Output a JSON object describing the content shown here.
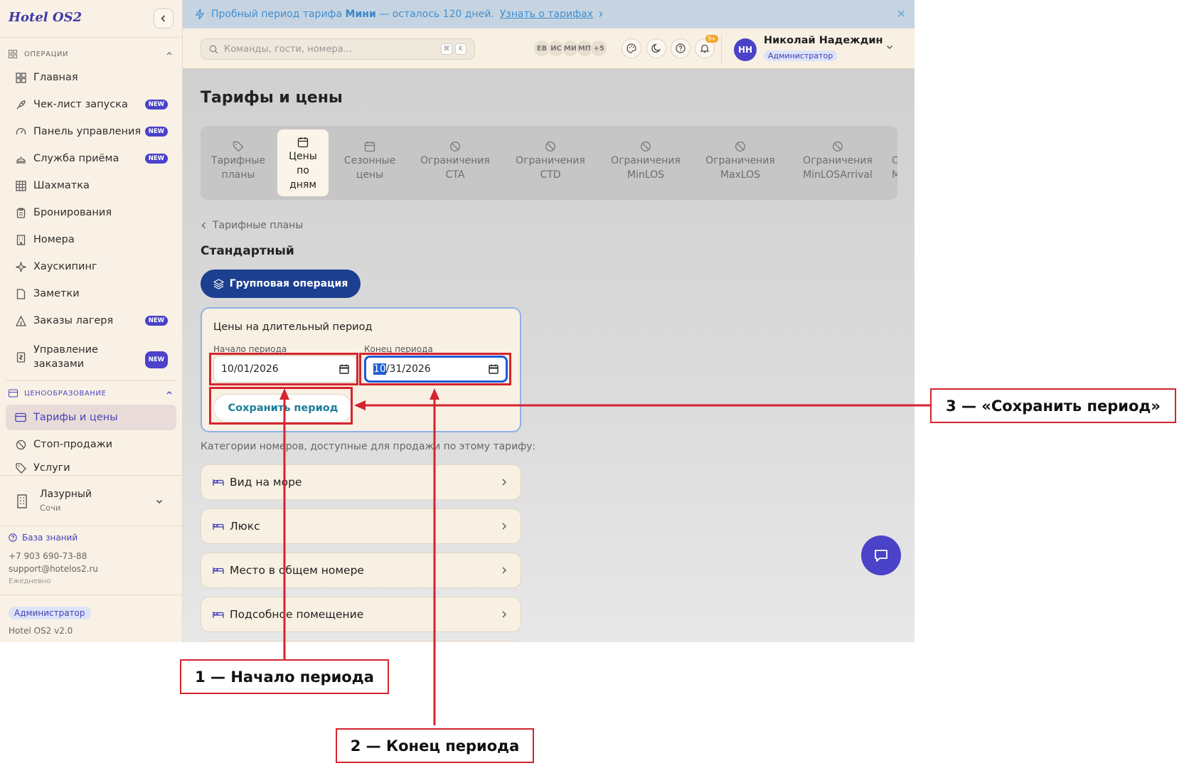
{
  "app": {
    "logo": "Hotel OS2"
  },
  "sidebar": {
    "section_ops": "ОПЕРАЦИИ",
    "section_pricing": "ЦЕНООБРАЗОВАНИЕ",
    "items": [
      {
        "label": "Главная",
        "icon": "dashboard-icon"
      },
      {
        "label": "Чек-лист запуска",
        "icon": "rocket-icon",
        "badge": "NEW"
      },
      {
        "label": "Панель управления",
        "icon": "gauge-icon",
        "badge": "NEW"
      },
      {
        "label": "Служба приёма",
        "icon": "bell-desk-icon",
        "badge": "NEW"
      },
      {
        "label": "Шахматка",
        "icon": "grid-icon"
      },
      {
        "label": "Бронирования",
        "icon": "clipboard-icon"
      },
      {
        "label": "Номера",
        "icon": "building-icon"
      },
      {
        "label": "Хаускипинг",
        "icon": "sparkle-icon"
      },
      {
        "label": "Заметки",
        "icon": "note-icon"
      },
      {
        "label": "Заказы лагеря",
        "icon": "tent-icon",
        "badge": "NEW"
      },
      {
        "label": "Управление заказами",
        "icon": "receipt-icon",
        "badge": "NEW"
      }
    ],
    "pricing_items": [
      {
        "label": "Тарифы и цены",
        "icon": "card-icon",
        "active": true
      },
      {
        "label": "Стоп-продажи",
        "icon": "ban-icon"
      },
      {
        "label": "Услуги",
        "icon": "tag-icon"
      }
    ],
    "hotel": {
      "name": "Лазурный",
      "city": "Сочи"
    },
    "knowledge_base": "База знаний",
    "phone": "+7 903 690-73-88",
    "email": "support@hotelos2.ru",
    "schedule": "Ежедневно",
    "role": "Администратор",
    "version": "Hotel OS2 v2.0"
  },
  "trial": {
    "prefix": "Пробный период тарифа",
    "plan": "Мини",
    "suffix": "— осталось 120 дней.",
    "link": "Узнать о тарифах"
  },
  "topbar": {
    "search_placeholder": "Команды, гости, номера...",
    "kbd1": "⌘",
    "kbd2": "K",
    "presence": [
      "ЕВ",
      "ИС",
      "МИ",
      "МП",
      "+5"
    ],
    "notifications": "9+",
    "user_initials": "НН",
    "user_name": "Николай Надеждин",
    "user_role": "Администратор"
  },
  "main": {
    "title": "Тарифы и цены",
    "tabs": [
      {
        "line1": "Тарифные",
        "line2": "планы",
        "icon": "tag-icon"
      },
      {
        "line1": "Цены",
        "line2": "по",
        "line3": "дням",
        "icon": "calendar-icon",
        "active": true
      },
      {
        "line1": "Сезонные",
        "line2": "цены",
        "icon": "calendar-icon"
      },
      {
        "line1": "Ограничения",
        "line2": "CTA",
        "icon": "ban-icon"
      },
      {
        "line1": "Ограничения",
        "line2": "CTD",
        "icon": "ban-icon"
      },
      {
        "line1": "Ограничения",
        "line2": "MinLOS",
        "icon": "ban-icon"
      },
      {
        "line1": "Ограничения",
        "line2": "MaxLOS",
        "icon": "ban-icon"
      },
      {
        "line1": "Ограничения",
        "line2": "MinLOSArrival",
        "icon": "ban-icon"
      },
      {
        "line1": "Ог",
        "line2": "Ma",
        "icon": "ban-icon"
      }
    ],
    "back": "Тарифные планы",
    "plan_name": "Стандартный",
    "group_button": "Групповая операция",
    "period": {
      "title": "Цены на длительный период",
      "start_label": "Начало периода",
      "start_value": "10/01/2026",
      "end_label": "Конец периода",
      "end_month_selected": "10",
      "end_rest": "/31/2026",
      "save": "Сохранить период"
    },
    "categories_note": "Категории номеров, доступные для продажи по этому тарифу:",
    "rooms": [
      "Вид на море",
      "Люкс",
      "Место в общем номере",
      "Подсобное помещение"
    ]
  },
  "annotations": {
    "a1": "1 — Начало периода",
    "a2": "2 — Конец периода",
    "a3": "3 — «Сохранить период»"
  },
  "colors": {
    "accent": "#4a42c8",
    "annotation": "#d4252e",
    "primary_button": "#1d3f8f"
  }
}
